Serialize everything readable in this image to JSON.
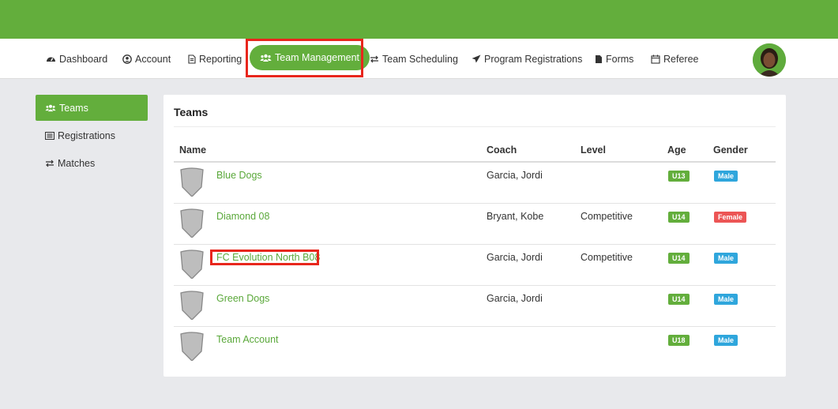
{
  "nav": {
    "dashboard": "Dashboard",
    "account": "Account",
    "reporting": "Reporting",
    "team_management": "Team Management",
    "team_scheduling": "Team Scheduling",
    "program_registrations": "Program Registrations",
    "forms": "Forms",
    "referee": "Referee"
  },
  "sidebar": {
    "items": [
      {
        "label": "Teams",
        "icon": "users-icon"
      },
      {
        "label": "Registrations",
        "icon": "list-icon"
      },
      {
        "label": "Matches",
        "icon": "exchange-icon"
      }
    ]
  },
  "panel": {
    "title": "Teams",
    "columns": {
      "name": "Name",
      "coach": "Coach",
      "level": "Level",
      "age": "Age",
      "gender": "Gender"
    }
  },
  "teams": [
    {
      "name": "Blue Dogs",
      "coach": "Garcia, Jordi",
      "level": "",
      "age": "U13",
      "gender": "Male"
    },
    {
      "name": "Diamond 08",
      "coach": "Bryant, Kobe",
      "level": "Competitive",
      "age": "U14",
      "gender": "Female"
    },
    {
      "name": "FC Evolution North B08",
      "coach": "Garcia, Jordi",
      "level": "Competitive",
      "age": "U14",
      "gender": "Male"
    },
    {
      "name": "Green Dogs",
      "coach": "Garcia, Jordi",
      "level": "",
      "age": "U14",
      "gender": "Male"
    },
    {
      "name": "Team Account",
      "coach": "",
      "level": "",
      "age": "U18",
      "gender": "Male"
    }
  ],
  "colors": {
    "brand_green": "#63ae3c",
    "male_badge": "#2fa6dc",
    "female_badge": "#ec5555",
    "highlight": "#e8261c"
  }
}
